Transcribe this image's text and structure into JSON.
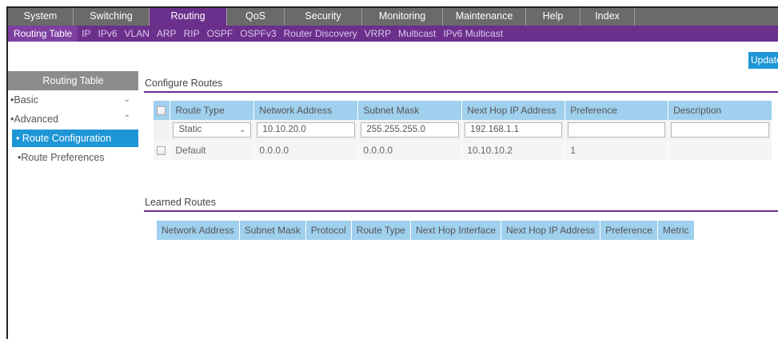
{
  "topnav": {
    "tabs": [
      {
        "label": "System",
        "width": 82
      },
      {
        "label": "Switching",
        "width": 95
      },
      {
        "label": "Routing",
        "width": 97,
        "active": true
      },
      {
        "label": "QoS",
        "width": 72
      },
      {
        "label": "Security",
        "width": 97
      },
      {
        "label": "Monitoring",
        "width": 101
      },
      {
        "label": "Maintenance",
        "width": 104
      },
      {
        "label": "Help",
        "width": 68
      },
      {
        "label": "Index",
        "width": 68
      }
    ]
  },
  "subnav": {
    "items": [
      {
        "label": "Routing Table",
        "active": true
      },
      {
        "label": "IP"
      },
      {
        "label": "IPv6"
      },
      {
        "label": "VLAN"
      },
      {
        "label": "ARP"
      },
      {
        "label": "RIP"
      },
      {
        "label": "OSPF"
      },
      {
        "label": "OSPFv3"
      },
      {
        "label": "Router Discovery"
      },
      {
        "label": "VRRP"
      },
      {
        "label": "Multicast"
      },
      {
        "label": "IPv6 Multicast"
      }
    ]
  },
  "update_label": "Update",
  "sidebar": {
    "title": "Routing Table",
    "basic": "Basic",
    "advanced": "Advanced",
    "route_configuration": "Route Configuration",
    "route_preferences": "Route Preferences"
  },
  "configure_routes": {
    "title": "Configure Routes",
    "headers": [
      "Route Type",
      "Network Address",
      "Subnet Mask",
      "Next Hop IP Address",
      "Preference",
      "Description"
    ],
    "edit_row": {
      "route_type": "Static",
      "network_address": "10.10.20.0",
      "subnet_mask": "255.255.255.0",
      "next_hop": "192.168.1.1",
      "preference": "",
      "description": ""
    },
    "default_row": {
      "route_type": "Default",
      "network_address": "0.0.0.0",
      "subnet_mask": "0.0.0.0",
      "next_hop": "10.10.10.2",
      "preference": "1",
      "description": ""
    }
  },
  "learned_routes": {
    "title": "Learned Routes",
    "headers": [
      "Network Address",
      "Subnet Mask",
      "Protocol",
      "Route Type",
      "Next Hop Interface",
      "Next Hop IP Address",
      "Preference",
      "Metric"
    ]
  },
  "colors": {
    "nav_gray": "#6a6a6a",
    "brand_purple": "#6b2f8c",
    "accent_blue": "#1e96d6",
    "table_header": "#9fd0ee"
  }
}
